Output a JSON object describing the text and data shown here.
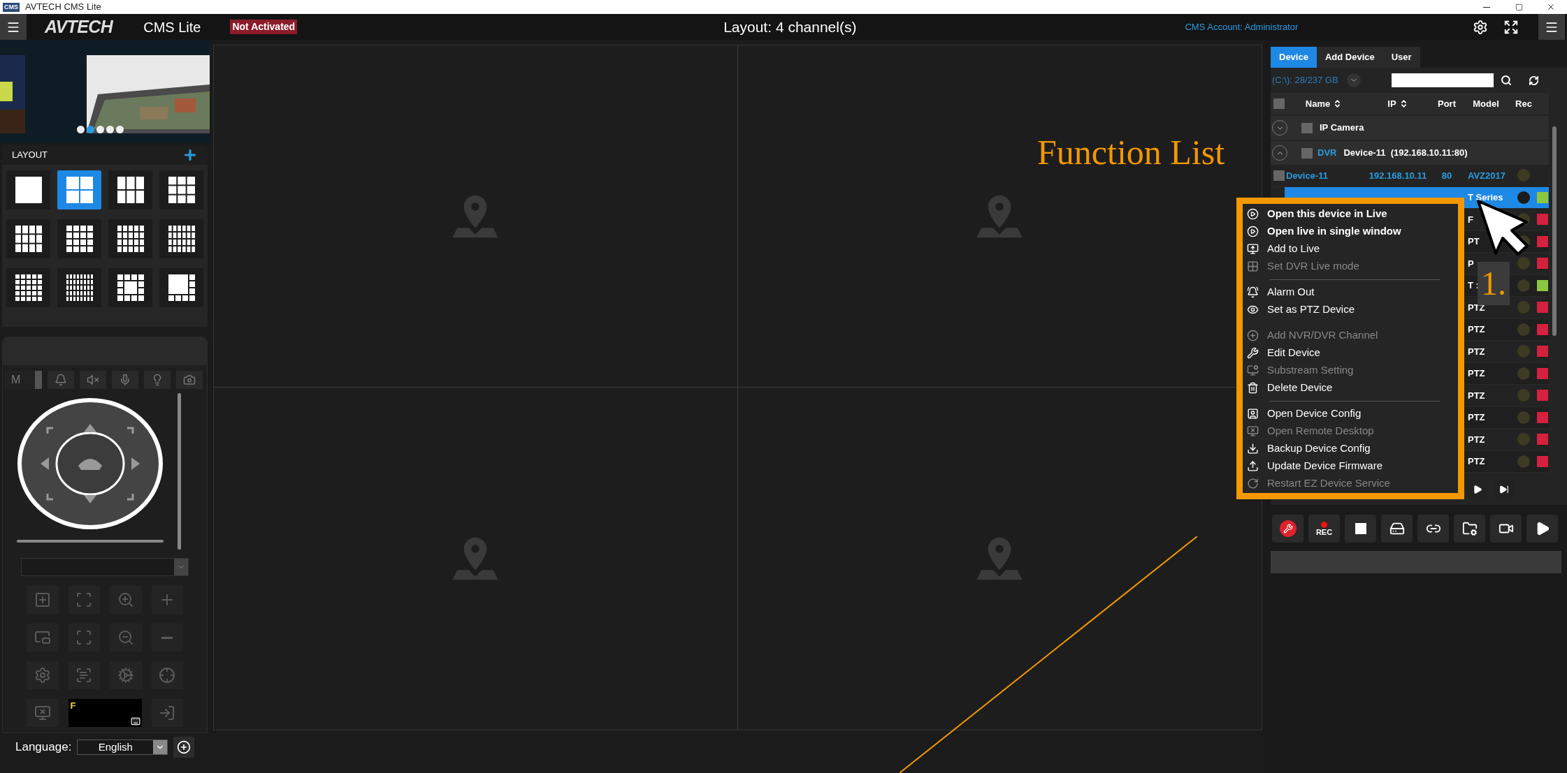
{
  "title_bar": {
    "icon_text": "CMS",
    "title": "AVTECH CMS Lite"
  },
  "header": {
    "logo": "AVTECH",
    "product": "CMS Lite",
    "activation": "Not Activated",
    "layout_title": "Layout: 4 channel(s)",
    "account": "CMS Account: Administrator"
  },
  "banner": {
    "dots": [
      {
        "selected": false
      },
      {
        "selected": true
      },
      {
        "selected": false
      },
      {
        "selected": false
      },
      {
        "selected": false
      }
    ]
  },
  "layout_panel": {
    "title": "LAYOUT",
    "layouts": [
      {
        "selected": false
      },
      {
        "selected": true
      },
      {
        "selected": false
      },
      {
        "selected": false
      },
      {
        "selected": false
      },
      {
        "selected": false
      },
      {
        "selected": false
      },
      {
        "selected": false
      },
      {
        "selected": false
      },
      {
        "selected": false
      },
      {
        "selected": false
      },
      {
        "selected": false
      }
    ]
  },
  "ptz": {
    "mode": "M",
    "zoom_slider": {
      "level": 1
    },
    "speed_slider": {
      "level": 1
    },
    "keypad_text": "F"
  },
  "language": {
    "label": "Language:",
    "value": "English"
  },
  "device_panel": {
    "tabs": [
      {
        "label": "Device",
        "selected": true
      },
      {
        "label": "Add Device",
        "selected": false
      },
      {
        "label": "User",
        "selected": false
      }
    ],
    "storage": "(C:\\): 28/237 GB",
    "select_all": {
      "checked": false
    },
    "columns": [
      "Name",
      "IP",
      "Port",
      "Model",
      "Rec"
    ],
    "groups": [
      {
        "name": "IP Camera",
        "expanded": false,
        "checked": false
      },
      {
        "type": "DVR",
        "name": "Device-11  (192.168.10.11:80)",
        "expanded": true,
        "checked": false,
        "rows": [
          {
            "name": "Device-11",
            "ip": "192.168.10.11",
            "port": "80",
            "model": "AVZ2017",
            "selected": false,
            "checked": false
          },
          {
            "model": "T Series",
            "selected": true,
            "color": "#8cc63f"
          },
          {
            "model": "F",
            "selected": false,
            "color": "#d4213d"
          },
          {
            "model": "PT",
            "selected": false,
            "color": "#d4213d"
          },
          {
            "model": "P",
            "selected": false,
            "color": "#d4213d"
          },
          {
            "model": "T :",
            "selected": false,
            "color": "#8cc63f"
          },
          {
            "model": "PTZ",
            "selected": false,
            "color": "#d4213d"
          },
          {
            "model": "PTZ",
            "selected": false,
            "color": "#d4213d"
          },
          {
            "model": "PTZ",
            "selected": false,
            "color": "#d4213d"
          },
          {
            "model": "PTZ",
            "selected": false,
            "color": "#d4213d"
          },
          {
            "model": "PTZ",
            "selected": false,
            "color": "#d4213d"
          },
          {
            "model": "PTZ",
            "selected": false,
            "color": "#d4213d"
          },
          {
            "model": "PTZ",
            "selected": false,
            "color": "#d4213d"
          },
          {
            "model": "PTZ",
            "selected": false,
            "color": "#d4213d"
          }
        ]
      }
    ]
  },
  "toolbar": {
    "rec_label": "REC"
  },
  "menu": {
    "items": [
      {
        "kind": "item",
        "label": "Open this device in Live",
        "bold": true,
        "disabled": false
      },
      {
        "kind": "item",
        "label": "Open live in single window",
        "bold": true,
        "disabled": false
      },
      {
        "kind": "item",
        "label": "Add to Live",
        "bold": false,
        "disabled": false
      },
      {
        "kind": "item",
        "label": "Set DVR Live mode",
        "bold": false,
        "disabled": true
      },
      {
        "kind": "separator"
      },
      {
        "kind": "item",
        "label": "Alarm Out",
        "bold": false,
        "disabled": false
      },
      {
        "kind": "item",
        "label": "Set as PTZ Device",
        "bold": false,
        "disabled": false
      },
      {
        "kind": "gap"
      },
      {
        "kind": "item",
        "label": "Add NVR/DVR Channel",
        "bold": false,
        "disabled": true
      },
      {
        "kind": "item",
        "label": "Edit Device",
        "bold": false,
        "disabled": false
      },
      {
        "kind": "item",
        "label": "Substream Setting",
        "bold": false,
        "disabled": true
      },
      {
        "kind": "item",
        "label": "Delete Device",
        "bold": false,
        "disabled": false
      },
      {
        "kind": "separator"
      },
      {
        "kind": "item",
        "label": "Open Device Config",
        "bold": false,
        "disabled": false
      },
      {
        "kind": "item",
        "label": "Open Remote Desktop",
        "bold": false,
        "disabled": true
      },
      {
        "kind": "item",
        "label": "Backup Device Config",
        "bold": false,
        "disabled": false
      },
      {
        "kind": "item",
        "label": "Update Device Firmware",
        "bold": false,
        "disabled": false
      },
      {
        "kind": "item",
        "label": "Restart EZ Device Service",
        "bold": false,
        "disabled": true
      }
    ]
  },
  "annotations": {
    "title": "Function List",
    "step": "1."
  }
}
